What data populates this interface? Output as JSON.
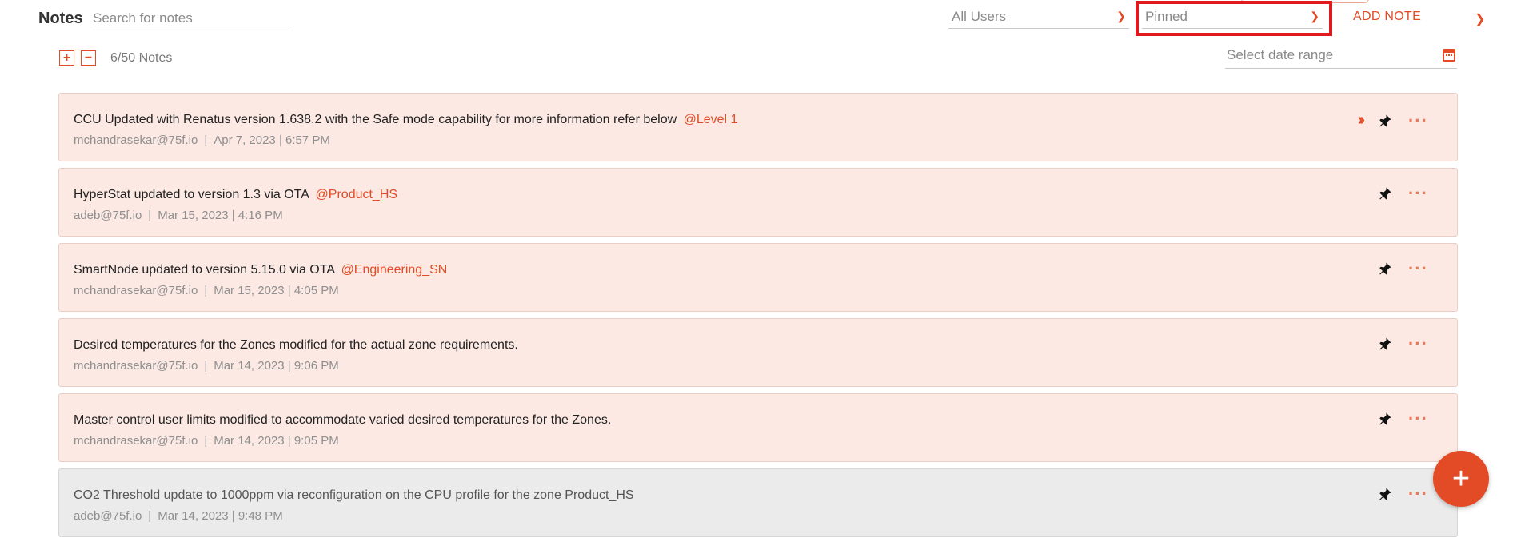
{
  "header": {
    "title": "Notes",
    "search_placeholder": "Search for notes",
    "users_filter": "All Users",
    "pin_filter": "Pinned",
    "add_note_label": "ADD NOTE"
  },
  "toolbar": {
    "expand_label": "+",
    "collapse_label": "−",
    "count": "6/50 Notes",
    "date_placeholder": "Select date range"
  },
  "notes": [
    {
      "text": "CCU Updated with Renatus version 1.638.2 with the Safe mode capability for more information refer below",
      "tag": "@Level 1",
      "author": "mchandrasekar@75f.io",
      "date": "Apr 7, 2023 | 6:57 PM",
      "has_expand": true
    },
    {
      "text": "HyperStat updated to version 1.3 via OTA",
      "tag": "@Product_HS",
      "author": "adeb@75f.io",
      "date": "Mar 15, 2023 | 4:16 PM"
    },
    {
      "text": "SmartNode updated to version 5.15.0  via OTA",
      "tag": "@Engineering_SN",
      "author": "mchandrasekar@75f.io",
      "date": "Mar 15, 2023 | 4:05 PM"
    },
    {
      "text": "Desired temperatures for the Zones modified for the actual zone requirements.",
      "tag": "",
      "author": "mchandrasekar@75f.io",
      "date": "Mar 14, 2023 | 9:06 PM"
    },
    {
      "text": "Master control user limits modified to accommodate varied desired temperatures for the Zones.",
      "tag": "",
      "author": "mchandrasekar@75f.io",
      "date": "Mar 14, 2023 | 9:05 PM"
    },
    {
      "text": "CO2 Threshold update to 1000ppm via reconfiguration on the CPU profile for the zone Product_HS",
      "tag": "",
      "author": "adeb@75f.io",
      "date": "Mar 14, 2023 | 9:48 PM",
      "gray": true
    }
  ],
  "icons": {
    "chevron": "chevron-down-icon",
    "calendar": "calendar-icon",
    "pin": "pin-icon",
    "more": "more-horizontal-icon",
    "expand": "double-chevron-right-icon",
    "fab": "plus-icon"
  },
  "colors": {
    "accent": "#e24b26",
    "note_bg": "#fce9e3",
    "note_gray_bg": "#ebebeb",
    "highlight": "#e0191f"
  },
  "fab_label": "+"
}
